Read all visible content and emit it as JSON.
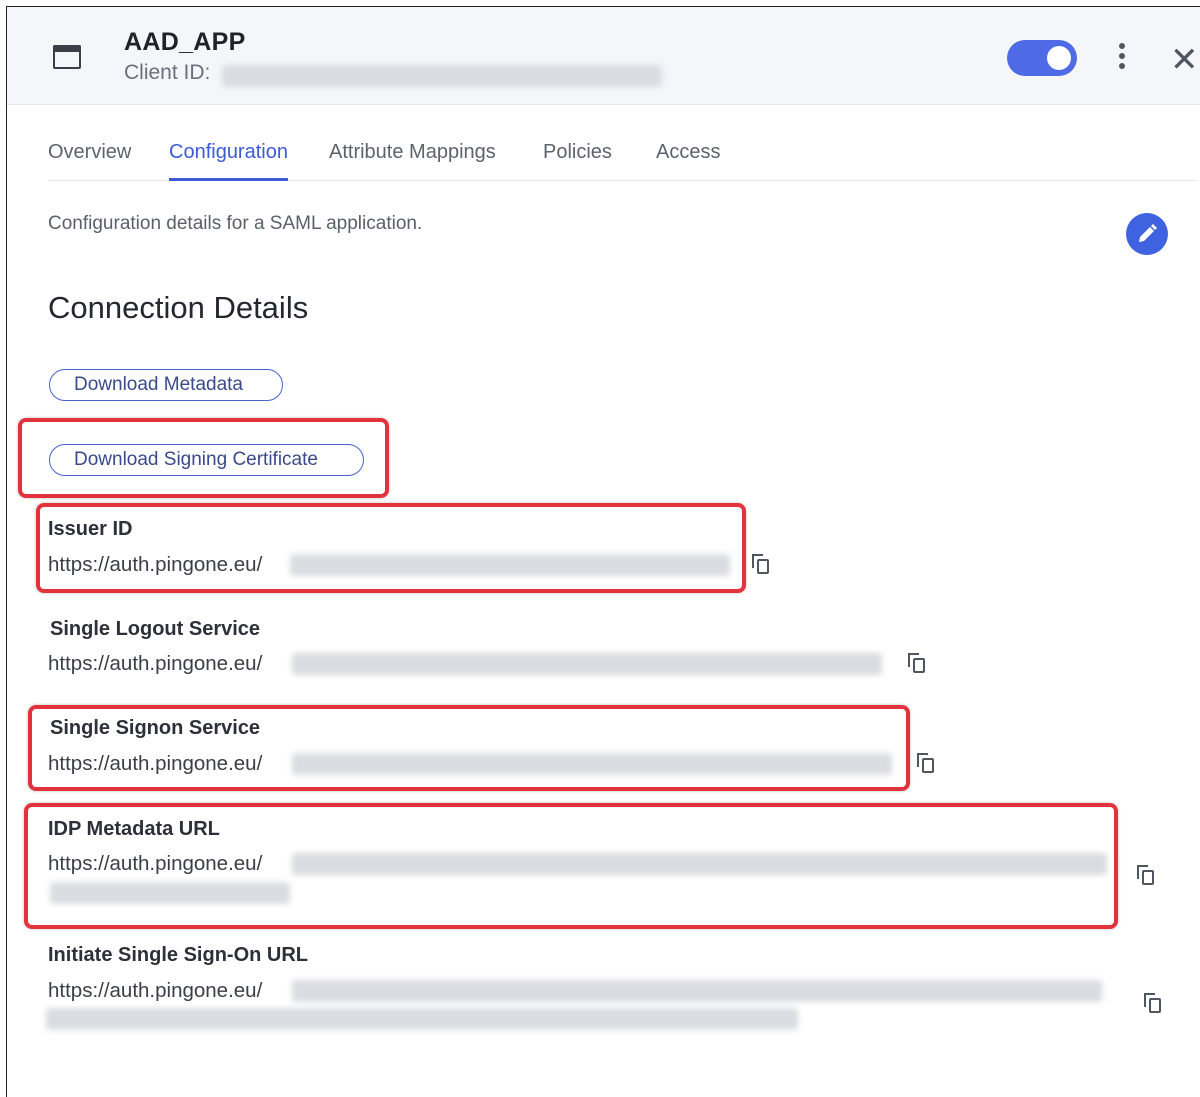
{
  "header": {
    "title": "AAD_APP",
    "client_id_label": "Client ID:"
  },
  "tabs": [
    {
      "label": "Overview"
    },
    {
      "label": "Configuration"
    },
    {
      "label": "Attribute Mappings"
    },
    {
      "label": "Policies"
    },
    {
      "label": "Access"
    }
  ],
  "description": "Configuration details for a SAML application.",
  "section_title": "Connection Details",
  "buttons": {
    "download_metadata": "Download Metadata",
    "download_signing_certificate": "Download Signing Certificate"
  },
  "fields": {
    "issuer_id": {
      "label": "Issuer ID",
      "value": "https://auth.pingone.eu/"
    },
    "single_logout": {
      "label": "Single Logout Service",
      "value": "https://auth.pingone.eu/"
    },
    "single_signon": {
      "label": "Single Signon Service",
      "value": "https://auth.pingone.eu/"
    },
    "idp_metadata": {
      "label": "IDP Metadata URL",
      "value": "https://auth.pingone.eu/"
    },
    "initiate_sso": {
      "label": "Initiate Single Sign-On URL",
      "value": "https://auth.pingone.eu/"
    }
  },
  "colors": {
    "accent": "#3c5bd6",
    "toggle_on": "#4e6ae6",
    "highlight": "#e2333c"
  },
  "icons": [
    "app-window-icon",
    "more-vertical-icon",
    "close-icon",
    "pencil-icon",
    "copy-icon"
  ],
  "toggle_enabled": true
}
